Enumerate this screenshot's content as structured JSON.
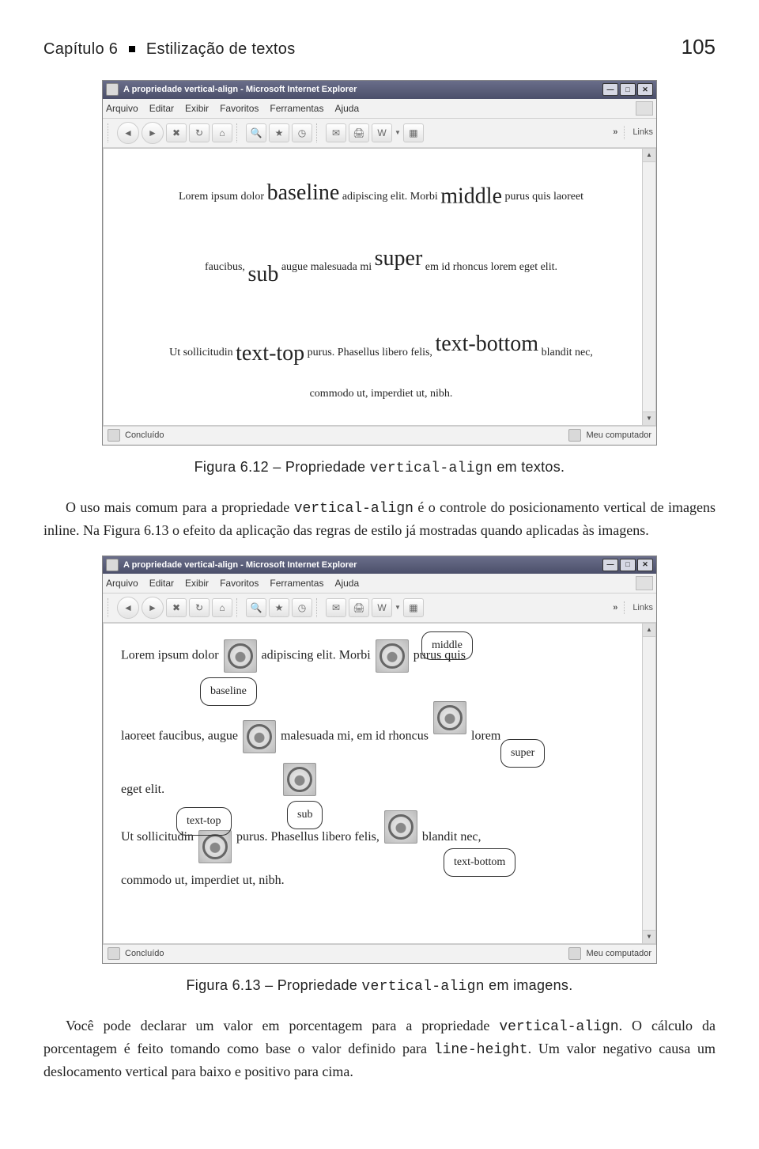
{
  "header": {
    "left_prefix": "Capítulo 6",
    "left_title": "Estilização de textos",
    "page_number": "105"
  },
  "browser": {
    "title": "A propriedade vertical-align - Microsoft Internet Explorer",
    "menus": [
      "Arquivo",
      "Editar",
      "Exibir",
      "Favoritos",
      "Ferramentas",
      "Ajuda"
    ],
    "links_label": "Links",
    "status_done": "Concluído",
    "status_zone": "Meu computador"
  },
  "sample1": {
    "line_a_pre": "Lorem ipsum dolor ",
    "w_baseline": "baseline",
    "line_a_mid1": " adipiscing elit. Morbi ",
    "w_middle": "middle",
    "line_a_post1": " purus quis laoreet",
    "line_b_pre": "faucibus, ",
    "w_sub": "sub",
    "line_b_mid": " augue malesuada mi ",
    "w_super": "super",
    "line_b_post": " em id rhoncus lorem eget elit.",
    "line_c_pre": "Ut sollicitudin ",
    "w_texttop": "text-top",
    "line_c_mid": " purus. Phasellus libero felis, ",
    "w_textbottom": "text-bottom",
    "line_c_post": " blandit nec,",
    "line_d": "commodo ut, imperdiet ut, nibh."
  },
  "caption1": {
    "label": "Figura 6.12 – Propriedade ",
    "code": "vertical-align",
    "tail": " em textos."
  },
  "para1": {
    "pre": "O uso mais comum para a propriedade ",
    "code": "vertical-align",
    "post": " é o controle do posicionamento vertical de imagens inline. Na Figura 6.13 o efeito da aplicação das regras de estilo já mostradas quando aplicadas às imagens."
  },
  "sample2": {
    "r1_a": "Lorem ipsum dolor ",
    "r1_b": " adipiscing elit. Morbi ",
    "r1_c": " purus quis",
    "tag_baseline": "baseline",
    "tag_middle": "middle",
    "r2_a": "laoreet faucibus, augue ",
    "r2_b": " malesuada mi, em id rhoncus ",
    "r2_c": " lorem",
    "tag_super": "super",
    "r3_a": "eget elit.",
    "tag_sub": "sub",
    "r4_a": "Ut sollicitudin ",
    "r4_b": " purus. Phasellus libero felis, ",
    "r4_c": " blandit nec,",
    "tag_texttop": "text-top",
    "tag_textbottom": "text-bottom",
    "r5": "commodo ut, imperdiet ut, nibh."
  },
  "caption2": {
    "label": "Figura 6.13 – Propriedade ",
    "code": "vertical-align",
    "tail": " em imagens."
  },
  "para2": {
    "pre": "Você pode declarar um valor em porcentagem para a propriedade ",
    "code1": "vertical-align",
    "mid": ". O cálculo da porcentagem é feito tomando como base o valor definido para ",
    "code2": "line-height",
    "post": ". Um valor negativo causa um deslocamento vertical para baixo e positivo para cima."
  }
}
